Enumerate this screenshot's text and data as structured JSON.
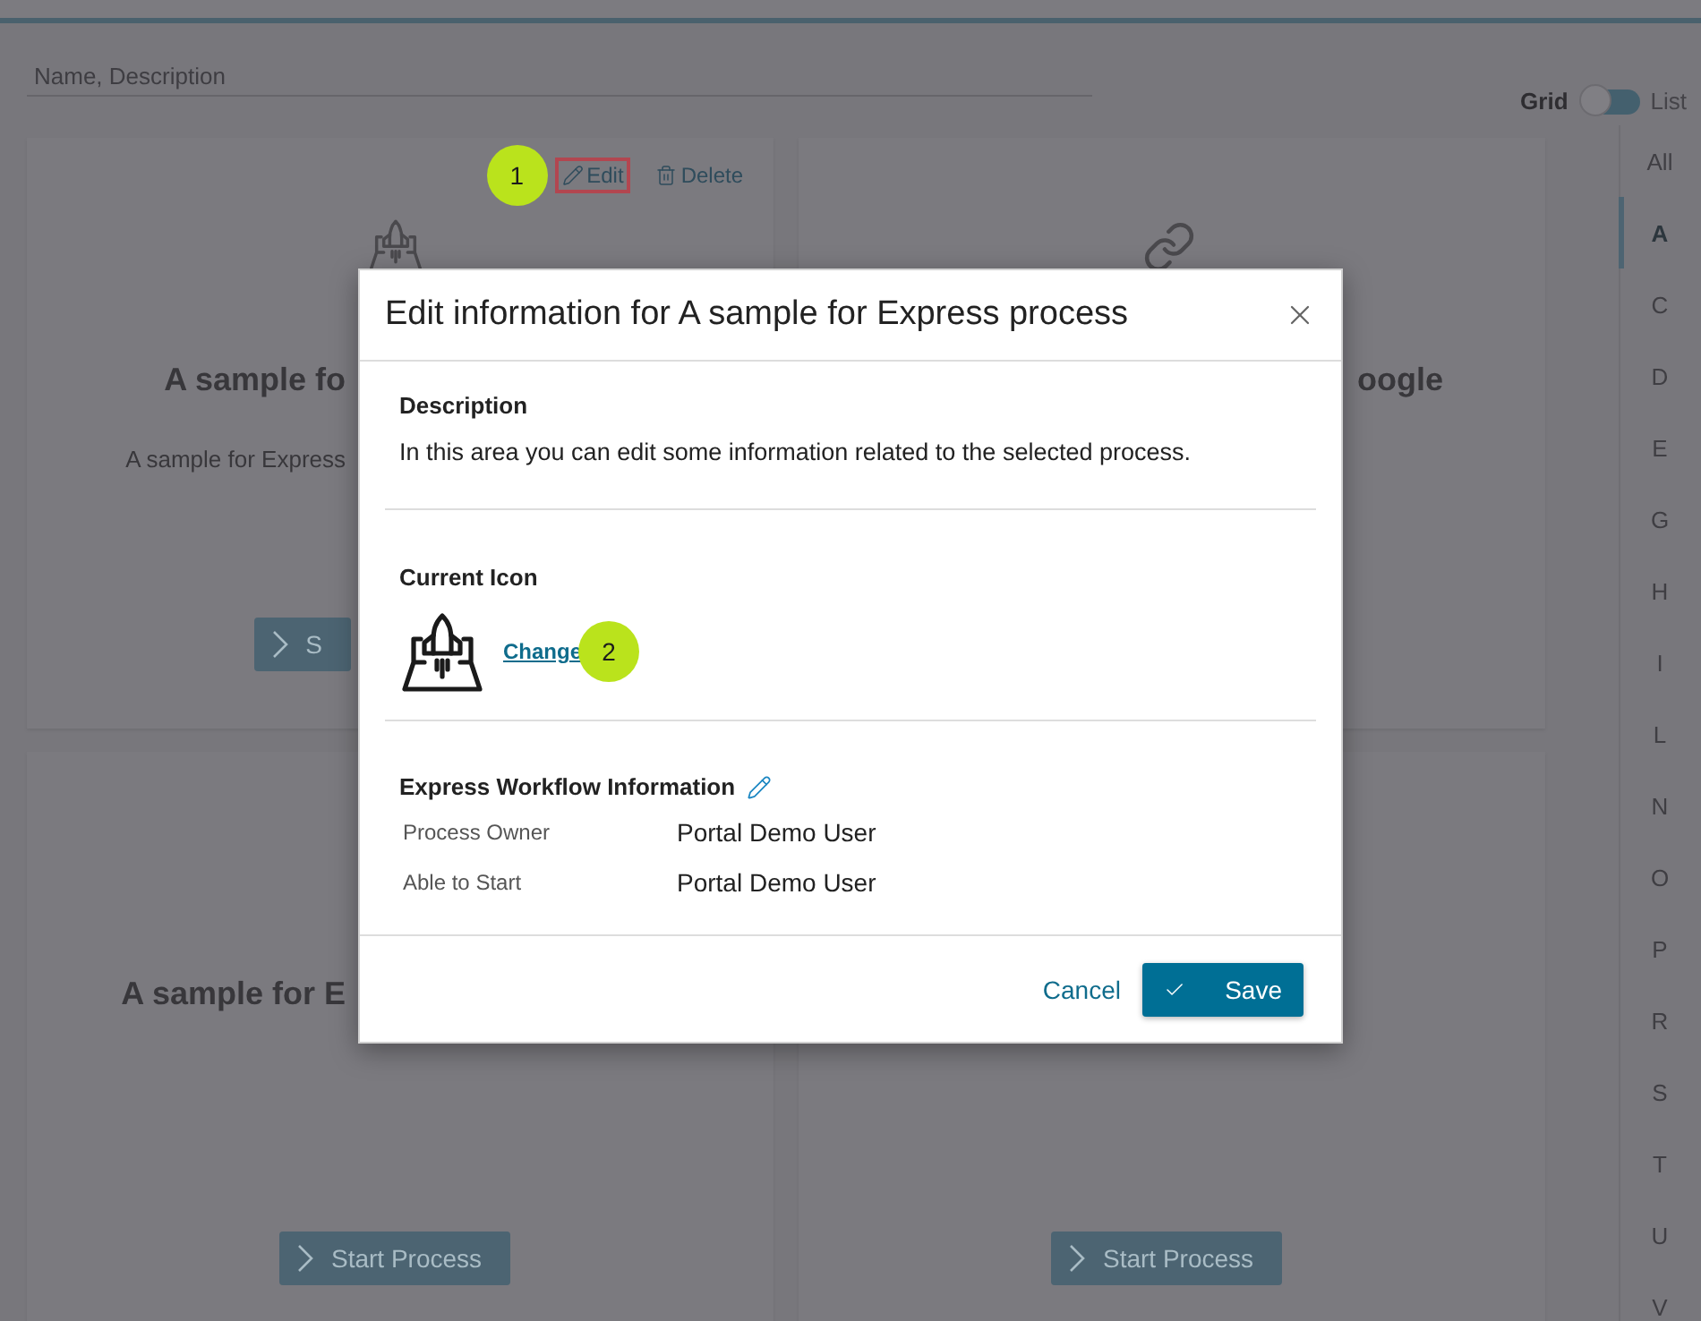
{
  "search": {
    "placeholder": "Name, Description"
  },
  "view_toggle": [
    {
      "label": "Grid",
      "selected": true
    },
    {
      "label": "List",
      "selected": false
    }
  ],
  "cards": [
    {
      "title": "A sample fo",
      "description": "A sample for Express",
      "button": "S",
      "actions": [
        {
          "kind": "annotation",
          "label": "1"
        },
        {
          "kind": "edit",
          "label": "Edit",
          "highlighted": true
        },
        {
          "kind": "delete",
          "label": "Delete",
          "highlighted": false
        }
      ]
    },
    {
      "title": "oogle"
    },
    {
      "title": "A sample for E",
      "button": "Start Process"
    },
    {
      "button": "Start Process"
    }
  ],
  "alphabet": [
    {
      "label": "All",
      "selected": false
    },
    {
      "label": "A",
      "selected": true
    },
    {
      "label": "C",
      "selected": false
    },
    {
      "label": "D",
      "selected": false
    },
    {
      "label": "E",
      "selected": false
    },
    {
      "label": "G",
      "selected": false
    },
    {
      "label": "H",
      "selected": false
    },
    {
      "label": "I",
      "selected": false
    },
    {
      "label": "L",
      "selected": false
    },
    {
      "label": "N",
      "selected": false
    },
    {
      "label": "O",
      "selected": false
    },
    {
      "label": "P",
      "selected": false
    },
    {
      "label": "R",
      "selected": false
    },
    {
      "label": "S",
      "selected": false
    },
    {
      "label": "T",
      "selected": false
    },
    {
      "label": "U",
      "selected": false
    },
    {
      "label": "V",
      "selected": false
    }
  ],
  "dialog": {
    "title": "Edit information for A sample for Express process",
    "description": {
      "heading": "Description",
      "text": "In this area you can edit some information related to the selected process."
    },
    "current_icon": {
      "heading": "Current Icon",
      "link": "Change",
      "annotation": "2"
    },
    "workflow": {
      "heading": "Express Workflow Information",
      "rows": [
        {
          "label": "Process Owner",
          "value": "Portal Demo User"
        },
        {
          "label": "Able to Start",
          "value": "Portal Demo User"
        }
      ]
    },
    "buttons": [
      {
        "kind": "cancel",
        "label": "Cancel"
      },
      {
        "kind": "save",
        "label": "Save"
      }
    ]
  }
}
